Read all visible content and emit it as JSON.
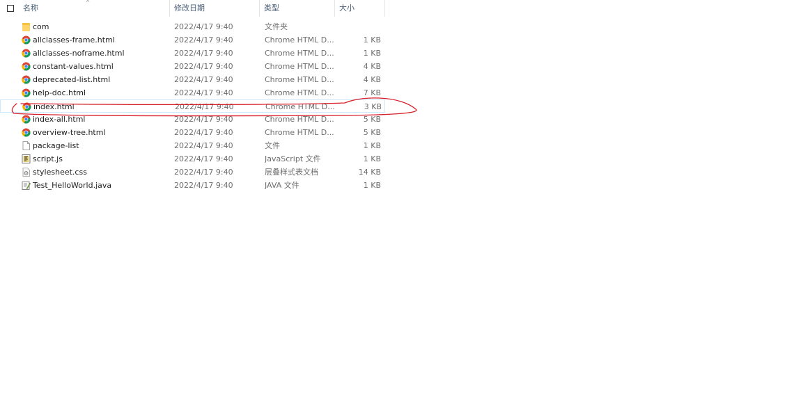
{
  "header": {
    "name": "名称",
    "date": "修改日期",
    "type": "类型",
    "size": "大小"
  },
  "files": [
    {
      "name": "com",
      "date": "2022/4/17 9:40",
      "type": "文件夹",
      "size": "",
      "icon": "folder-icon"
    },
    {
      "name": "allclasses-frame.html",
      "date": "2022/4/17 9:40",
      "type": "Chrome HTML D...",
      "size": "1 KB",
      "icon": "chrome-icon"
    },
    {
      "name": "allclasses-noframe.html",
      "date": "2022/4/17 9:40",
      "type": "Chrome HTML D...",
      "size": "1 KB",
      "icon": "chrome-icon"
    },
    {
      "name": "constant-values.html",
      "date": "2022/4/17 9:40",
      "type": "Chrome HTML D...",
      "size": "4 KB",
      "icon": "chrome-icon"
    },
    {
      "name": "deprecated-list.html",
      "date": "2022/4/17 9:40",
      "type": "Chrome HTML D...",
      "size": "4 KB",
      "icon": "chrome-icon"
    },
    {
      "name": "help-doc.html",
      "date": "2022/4/17 9:40",
      "type": "Chrome HTML D...",
      "size": "7 KB",
      "icon": "chrome-icon"
    },
    {
      "name": "index.html",
      "date": "2022/4/17 9:40",
      "type": "Chrome HTML D...",
      "size": "3 KB",
      "icon": "chrome-icon",
      "selected": true
    },
    {
      "name": "index-all.html",
      "date": "2022/4/17 9:40",
      "type": "Chrome HTML D...",
      "size": "5 KB",
      "icon": "chrome-icon"
    },
    {
      "name": "overview-tree.html",
      "date": "2022/4/17 9:40",
      "type": "Chrome HTML D...",
      "size": "5 KB",
      "icon": "chrome-icon"
    },
    {
      "name": "package-list",
      "date": "2022/4/17 9:40",
      "type": "文件",
      "size": "1 KB",
      "icon": "blank-file-icon"
    },
    {
      "name": "script.js",
      "date": "2022/4/17 9:40",
      "type": "JavaScript 文件",
      "size": "1 KB",
      "icon": "script-file-icon"
    },
    {
      "name": "stylesheet.css",
      "date": "2022/4/17 9:40",
      "type": "层叠样式表文档",
      "size": "14 KB",
      "icon": "css-file-icon"
    },
    {
      "name": "Test_HelloWorld.java",
      "date": "2022/4/17 9:40",
      "type": "JAVA 文件",
      "size": "1 KB",
      "icon": "java-file-icon"
    }
  ],
  "colors": {
    "header_text": "#4c607a",
    "row_text": "#1e1e1e",
    "meta_text": "#6d6d6d",
    "selection_border": "#cde8ff",
    "annotation_red": "#d81e2a"
  }
}
